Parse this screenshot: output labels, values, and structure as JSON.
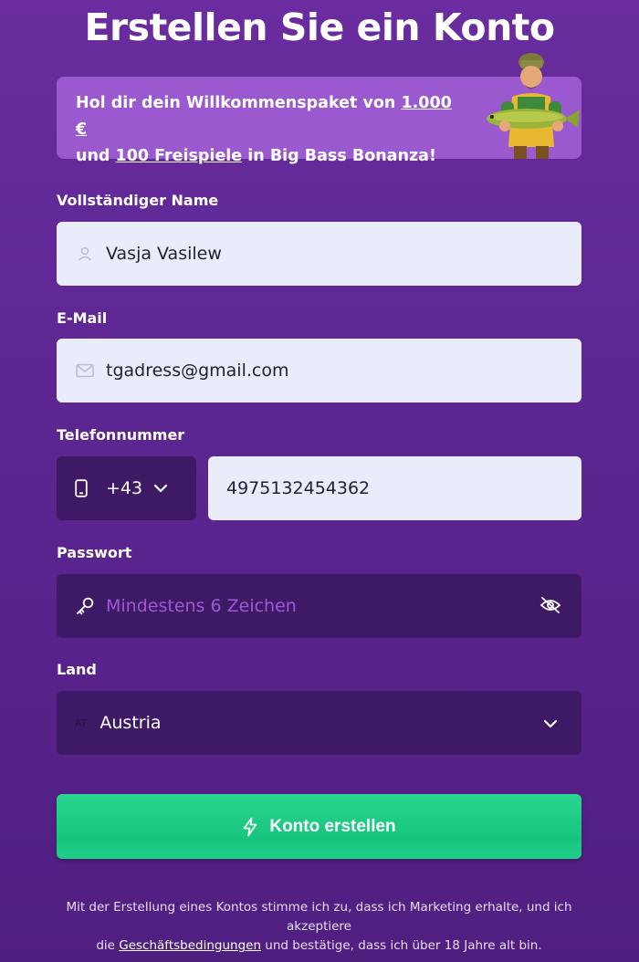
{
  "page": {
    "title": "Erstellen Sie ein Konto"
  },
  "banner": {
    "text_1": "Hol dir dein Willkommenspaket von ",
    "amount": "1.000 €",
    "text_2": "und ",
    "spins": "100 Freispiele",
    "text_3": " in Big Bass Bonanza!"
  },
  "form": {
    "name_label": "Vollständiger Name",
    "name_value": "Vasja Vasilew",
    "email_label": "E-Mail",
    "email_value": "tgadress@gmail.com",
    "phone_label": "Telefonnummer",
    "phone_code": "+43",
    "phone_value": "4975132454362",
    "password_label": "Passwort",
    "password_placeholder": "Mindestens 6 Zeichen",
    "country_label": "Land",
    "country_flag": "AT",
    "country_value": "Austria",
    "submit_label": "Konto erstellen"
  },
  "terms": {
    "line_1": "Mit der Erstellung eines Kontos stimme ich zu, dass ich Marketing erhalte, und ich akzeptiere",
    "line_2_prefix": "die ",
    "link": "Geschäftsbedingungen",
    "line_2_suffix": " und bestätige, dass ich über 18 Jahre alt bin."
  },
  "colors": {
    "background": "#5e2794",
    "banner": "#9b59d0",
    "input_light": "#e8ecfb",
    "input_dark": "#3e1a66",
    "submit": "#17c47e"
  },
  "icons": [
    "user-icon",
    "mail-icon",
    "phone-icon",
    "chevron-down-icon",
    "key-icon",
    "eye-off-icon",
    "bolt-icon"
  ]
}
